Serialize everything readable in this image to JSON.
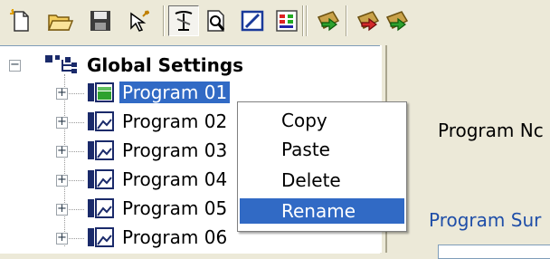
{
  "toolbar": {
    "buttons": [
      {
        "icon": "new-file-icon"
      },
      {
        "icon": "open-folder-icon"
      },
      {
        "icon": "save-icon"
      },
      {
        "icon": "wand-cursor-icon"
      },
      {
        "icon": "tool-pressed-icon",
        "pressed": true
      },
      {
        "icon": "print-preview-icon"
      },
      {
        "icon": "edit-icon"
      },
      {
        "icon": "palette-icon"
      },
      {
        "icon": "transfer-green-icon"
      },
      {
        "icon": "transfer-red-icon"
      },
      {
        "icon": "transfer-partial-icon"
      }
    ]
  },
  "tree": {
    "root": {
      "label": "Global Settings",
      "expander": "−"
    },
    "items": [
      {
        "label": "Program 01",
        "selected": true,
        "expander": "+"
      },
      {
        "label": "Program 02",
        "selected": false,
        "expander": "+"
      },
      {
        "label": "Program 03",
        "selected": false,
        "expander": "+"
      },
      {
        "label": "Program 04",
        "selected": false,
        "expander": "+"
      },
      {
        "label": "Program 05",
        "selected": false,
        "expander": "+"
      },
      {
        "label": "Program 06",
        "selected": false,
        "expander": "+"
      }
    ]
  },
  "context_menu": {
    "items": [
      {
        "label": "Copy",
        "highlighted": false
      },
      {
        "label": "Paste",
        "highlighted": false
      },
      {
        "label": "Delete",
        "highlighted": false
      },
      {
        "label": "Rename",
        "highlighted": true
      }
    ]
  },
  "right_panel": {
    "program_name_label": "Program Nc",
    "program_summary_label": "Program Sur"
  },
  "colors": {
    "selection": "#316ac5",
    "link_blue": "#1f4ea8",
    "window_bg": "#ece9d8"
  }
}
